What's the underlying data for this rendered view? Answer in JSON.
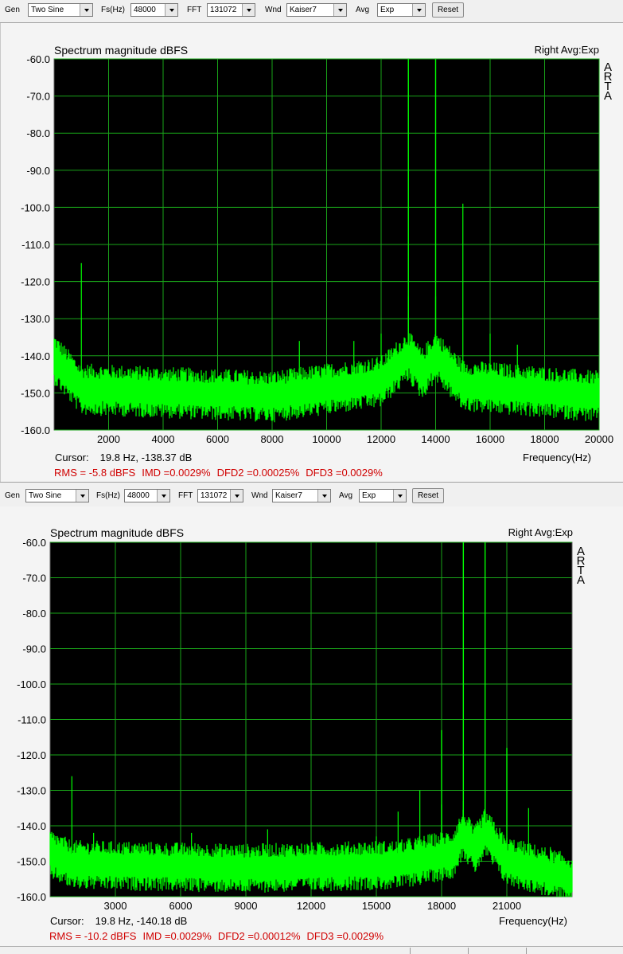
{
  "panels": [
    {
      "toolbar": {
        "gen_label": "Gen",
        "gen_value": "Two Sine",
        "fs_label": "Fs(Hz)",
        "fs_value": "48000",
        "fft_label": "FFT",
        "fft_value": "131072",
        "wnd_label": "Wnd",
        "wnd_value": "Kaiser7",
        "avg_label": "Avg",
        "avg_value": "Exp",
        "reset_label": "Reset"
      },
      "graph": {
        "title": "Spectrum magnitude dBFS",
        "right_title": "Right Avg:Exp",
        "arta": [
          "A",
          "R",
          "T",
          "A"
        ],
        "cursor_label": "Cursor:",
        "cursor_value": "19.8 Hz, -138.37 dB",
        "xlabel": "Frequency(Hz)",
        "stats": {
          "rms": "RMS =   -5.8 dBFS",
          "imd": "IMD =0.0029%",
          "dfd2": "DFD2 =0.00025%",
          "dfd3": "DFD3 =0.0029%"
        }
      }
    },
    {
      "toolbar": {
        "gen_label": "Gen",
        "gen_value": "Two Sine",
        "fs_label": "Fs(Hz)",
        "fs_value": "48000",
        "fft_label": "FFT",
        "fft_value": "131072",
        "wnd_label": "Wnd",
        "wnd_value": "Kaiser7",
        "avg_label": "Avg",
        "avg_value": "Exp",
        "reset_label": "Reset"
      },
      "graph": {
        "title": "Spectrum magnitude dBFS",
        "right_title": "Right Avg:Exp",
        "arta": [
          "A",
          "R",
          "T",
          "A"
        ],
        "cursor_label": "Cursor:",
        "cursor_value": "19.8 Hz, -140.18 dB",
        "xlabel": "Frequency(Hz)",
        "stats": {
          "rms": "RMS =  -10.2 dBFS",
          "imd": "IMD =0.0029%",
          "dfd2": "DFD2 =0.00012%",
          "dfd3": "DFD3 =0.0029%"
        }
      }
    }
  ],
  "colors": {
    "plot_bg": "#000000",
    "grid": "#19a319",
    "trace": "#00ff00",
    "stats_text": "#d00000"
  },
  "chart_data": [
    {
      "type": "line",
      "title": "Spectrum magnitude dBFS",
      "xlabel": "Frequency(Hz)",
      "ylabel": "",
      "xlim": [
        0,
        20000
      ],
      "ylim": [
        -160,
        -60
      ],
      "x_ticks": [
        2000,
        4000,
        6000,
        8000,
        10000,
        12000,
        14000,
        16000,
        18000,
        20000
      ],
      "y_ticks": [
        -60,
        -70,
        -80,
        -90,
        -100,
        -110,
        -120,
        -130,
        -140,
        -150,
        -160
      ],
      "grid": true,
      "noise_floor_db": [
        [
          20,
          -141
        ],
        [
          1000,
          -149
        ],
        [
          8000,
          -151
        ],
        [
          12000,
          -147
        ],
        [
          13000,
          -140
        ],
        [
          13500,
          -145
        ],
        [
          14000,
          -140
        ],
        [
          15000,
          -148
        ],
        [
          20000,
          -151
        ]
      ],
      "peaks": [
        {
          "freq": 1000,
          "db": -115
        },
        {
          "freq": 9000,
          "db": -136
        },
        {
          "freq": 11000,
          "db": -136
        },
        {
          "freq": 12000,
          "db": -134
        },
        {
          "freq": 13000,
          "db": -124
        },
        {
          "freq": 14000,
          "db": -124
        },
        {
          "freq": 15000,
          "db": -99
        },
        {
          "freq": 16000,
          "db": -134
        },
        {
          "freq": 17000,
          "db": -137
        }
      ],
      "tall_peaks": [
        {
          "freq": 13000,
          "db": -60
        },
        {
          "freq": 14000,
          "db": -60
        }
      ]
    },
    {
      "type": "line",
      "title": "Spectrum magnitude dBFS",
      "xlabel": "Frequency(Hz)",
      "ylabel": "",
      "xlim": [
        0,
        24000
      ],
      "ylim": [
        -160,
        -60
      ],
      "x_ticks": [
        3000,
        6000,
        9000,
        12000,
        15000,
        18000,
        21000
      ],
      "y_ticks": [
        -60,
        -70,
        -80,
        -90,
        -100,
        -110,
        -120,
        -130,
        -140,
        -150,
        -160
      ],
      "grid": true,
      "noise_floor_db": [
        [
          20,
          -148
        ],
        [
          1000,
          -151
        ],
        [
          9000,
          -152
        ],
        [
          16000,
          -151
        ],
        [
          18500,
          -148
        ],
        [
          19000,
          -142
        ],
        [
          19500,
          -147
        ],
        [
          20000,
          -142
        ],
        [
          21000,
          -150
        ],
        [
          24000,
          -155
        ]
      ],
      "peaks": [
        {
          "freq": 1000,
          "db": -126
        },
        {
          "freq": 2000,
          "db": -142
        },
        {
          "freq": 6500,
          "db": -142
        },
        {
          "freq": 10000,
          "db": -141
        },
        {
          "freq": 15000,
          "db": -143
        },
        {
          "freq": 16000,
          "db": -136
        },
        {
          "freq": 17000,
          "db": -130
        },
        {
          "freq": 18000,
          "db": -134
        },
        {
          "freq": 19000,
          "db": -133
        },
        {
          "freq": 20000,
          "db": -130
        },
        {
          "freq": 21000,
          "db": -144
        },
        {
          "freq": 22000,
          "db": -135
        },
        {
          "freq": 23000,
          "db": -146
        }
      ],
      "tall_peaks": [
        {
          "freq": 18000,
          "db": -113
        },
        {
          "freq": 19000,
          "db": -60
        },
        {
          "freq": 20000,
          "db": -60
        },
        {
          "freq": 21000,
          "db": -118
        }
      ]
    }
  ]
}
